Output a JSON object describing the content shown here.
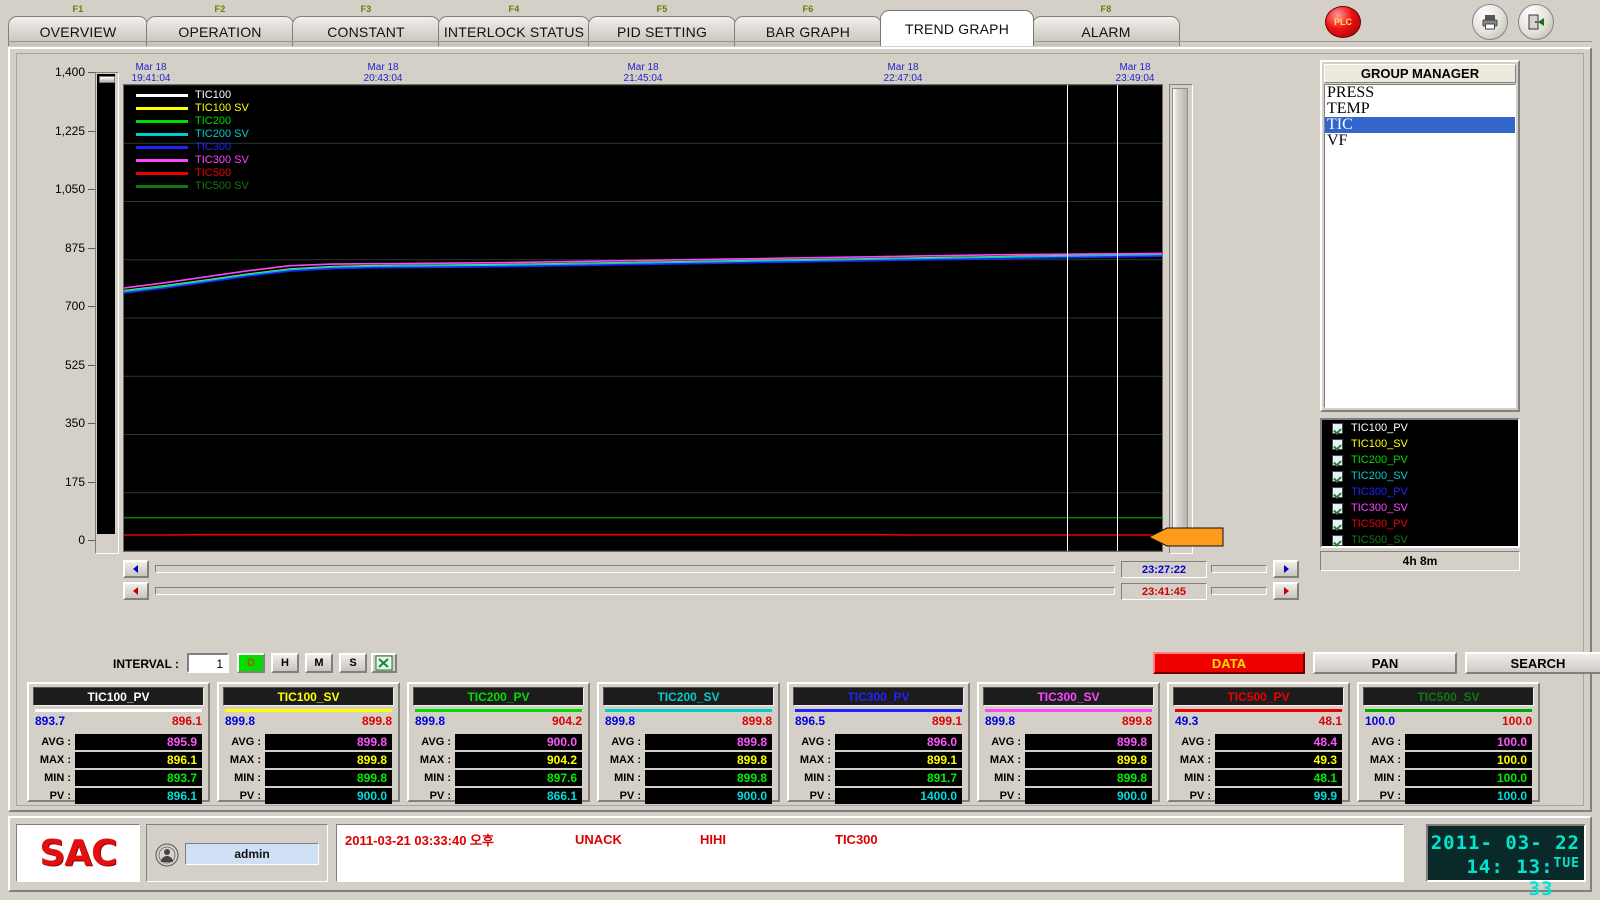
{
  "tabs": [
    {
      "fkey": "F1",
      "label": "OVERVIEW",
      "active": false
    },
    {
      "fkey": "F2",
      "label": "OPERATION",
      "active": false
    },
    {
      "fkey": "F3",
      "label": "CONSTANT",
      "active": false
    },
    {
      "fkey": "F4",
      "label": "INTERLOCK STATUS",
      "active": false
    },
    {
      "fkey": "F5",
      "label": "PID SETTING",
      "active": false
    },
    {
      "fkey": "F6",
      "label": "BAR GRAPH",
      "active": false
    },
    {
      "fkey": "",
      "label": "TREND GRAPH",
      "active": true
    },
    {
      "fkey": "F8",
      "label": "ALARM",
      "active": false
    }
  ],
  "titlebar": {
    "plc_label": "PLC",
    "plc_color": "#ee1111",
    "print_icon": "printer-icon",
    "exit_icon": "exit-door-icon"
  },
  "chart_data": {
    "type": "line",
    "title": "",
    "xlabel": "",
    "ylabel": "",
    "ylim": [
      0,
      1400
    ],
    "yticks": [
      "0",
      "175",
      "350",
      "525",
      "700",
      "875",
      "1,050",
      "1,225",
      "1,400"
    ],
    "grid": true,
    "legend_position": "top-left",
    "x_tick_labels": [
      {
        "date": "Mar 18",
        "time": "19:41:04"
      },
      {
        "date": "Mar 18",
        "time": "20:43:04"
      },
      {
        "date": "Mar 18",
        "time": "21:45:04"
      },
      {
        "date": "Mar 18",
        "time": "22:47:04"
      },
      {
        "date": "Mar 18",
        "time": "23:49:04"
      }
    ],
    "series": [
      {
        "name": "TIC100",
        "color": "#ffffff",
        "values": [
          780,
          795,
          812,
          830,
          845,
          852,
          855,
          856,
          857,
          858,
          860,
          862,
          864,
          866,
          868,
          870,
          872,
          874,
          876,
          878,
          880,
          882,
          884,
          886,
          888,
          890
        ]
      },
      {
        "name": "TIC100 SV",
        "color": "#ffff00",
        "values": [
          782,
          797,
          814,
          832,
          847,
          854,
          857,
          858,
          859,
          860,
          862,
          864,
          866,
          868,
          870,
          872,
          874,
          876,
          878,
          880,
          882,
          884,
          886,
          888,
          890,
          892
        ]
      },
      {
        "name": "TIC200",
        "color": "#00dd00",
        "values": [
          778,
          793,
          810,
          828,
          843,
          850,
          853,
          854,
          855,
          856,
          858,
          860,
          862,
          864,
          866,
          868,
          870,
          872,
          874,
          876,
          878,
          880,
          882,
          884,
          886,
          888
        ]
      },
      {
        "name": "TIC200 SV",
        "color": "#00cccc",
        "values": [
          781,
          796,
          813,
          831,
          846,
          853,
          856,
          857,
          858,
          859,
          861,
          863,
          865,
          867,
          869,
          871,
          873,
          875,
          877,
          879,
          881,
          883,
          885,
          887,
          889,
          891
        ]
      },
      {
        "name": "TIC300",
        "color": "#2222ff",
        "values": [
          775,
          790,
          808,
          826,
          841,
          848,
          851,
          852,
          853,
          854,
          856,
          858,
          860,
          862,
          864,
          866,
          868,
          870,
          872,
          874,
          876,
          878,
          880,
          882,
          884,
          886
        ]
      },
      {
        "name": "TIC300 SV",
        "color": "#ff44ff",
        "values": [
          790,
          806,
          824,
          842,
          857,
          862,
          863,
          864,
          865,
          866,
          868,
          870,
          872,
          874,
          876,
          878,
          880,
          882,
          884,
          886,
          888,
          890,
          891,
          892,
          893,
          894
        ]
      },
      {
        "name": "TIC500",
        "color": "#ee0000",
        "values": [
          48,
          48,
          49,
          49,
          49,
          49,
          49,
          49,
          49,
          49,
          49,
          49,
          49,
          49,
          49,
          49,
          49,
          49,
          49,
          48,
          48,
          48,
          48,
          48,
          48,
          48
        ]
      },
      {
        "name": "TIC500 SV",
        "color": "#117711",
        "values": [
          100,
          100,
          100,
          100,
          100,
          100,
          100,
          100,
          100,
          100,
          100,
          100,
          100,
          100,
          100,
          100,
          100,
          100,
          100,
          100,
          100,
          100,
          100,
          100,
          100,
          100
        ]
      }
    ],
    "cursors": [
      {
        "name": "cursor-a",
        "time": "23:27:22",
        "color": "#0000cc",
        "x_frac": 0.908
      },
      {
        "name": "cursor-b",
        "time": "23:41:45",
        "color": "#cc0000",
        "x_frac": 0.957
      }
    ]
  },
  "group_manager": {
    "title": "GROUP MANAGER",
    "items": [
      {
        "label": "PRESS",
        "selected": false
      },
      {
        "label": "TEMP",
        "selected": false
      },
      {
        "label": "TIC",
        "selected": true
      },
      {
        "label": "VF",
        "selected": false
      }
    ]
  },
  "tag_checklist": [
    {
      "label": "TIC100_PV",
      "color": "#ffffff",
      "checked": true
    },
    {
      "label": "TIC100_SV",
      "color": "#ffff00",
      "checked": true
    },
    {
      "label": "TIC200_PV",
      "color": "#00dd00",
      "checked": true
    },
    {
      "label": "TIC200_SV",
      "color": "#00cccc",
      "checked": true
    },
    {
      "label": "TIC300_PV",
      "color": "#2222ff",
      "checked": true
    },
    {
      "label": "TIC300_SV",
      "color": "#ff44ff",
      "checked": true
    },
    {
      "label": "TIC500_PV",
      "color": "#ee0000",
      "checked": true
    },
    {
      "label": "TIC500_SV",
      "color": "#117711",
      "checked": true
    }
  ],
  "duration_label": "4h 8m",
  "toolbar": {
    "interval_label": "INTERVAL :",
    "interval_value": "1",
    "unit_buttons": [
      {
        "label": "D",
        "active": true
      },
      {
        "label": "H",
        "active": false
      },
      {
        "label": "M",
        "active": false
      },
      {
        "label": "S",
        "active": false
      }
    ],
    "excel_icon": "excel-export-icon",
    "mode_buttons": [
      {
        "label": "DATA",
        "active": true
      },
      {
        "label": "PAN",
        "active": false
      },
      {
        "label": "SEARCH",
        "active": false
      }
    ]
  },
  "panels": [
    {
      "title": "TIC100_PV",
      "title_color": "#ffffff",
      "bar_color": "#ffffff",
      "lo": "893.7",
      "hi": "896.1",
      "rows": [
        {
          "key": "AVG :",
          "value": "895.9",
          "color": "#ff55ff"
        },
        {
          "key": "MAX :",
          "value": "896.1",
          "color": "#ffff00"
        },
        {
          "key": "MIN :",
          "value": "893.7",
          "color": "#00ee00"
        },
        {
          "key": "PV :",
          "value": "896.1",
          "color": "#00dddd"
        }
      ]
    },
    {
      "title": "TIC100_SV",
      "title_color": "#ffff00",
      "bar_color": "#ffff00",
      "lo": "899.8",
      "hi": "899.8",
      "rows": [
        {
          "key": "AVG :",
          "value": "899.8",
          "color": "#ff55ff"
        },
        {
          "key": "MAX :",
          "value": "899.8",
          "color": "#ffff00"
        },
        {
          "key": "MIN :",
          "value": "899.8",
          "color": "#00ee00"
        },
        {
          "key": "PV :",
          "value": "900.0",
          "color": "#00dddd"
        }
      ]
    },
    {
      "title": "TIC200_PV",
      "title_color": "#00dd00",
      "bar_color": "#00dd00",
      "lo": "899.8",
      "hi": "904.2",
      "rows": [
        {
          "key": "AVG :",
          "value": "900.0",
          "color": "#ff55ff"
        },
        {
          "key": "MAX :",
          "value": "904.2",
          "color": "#ffff00"
        },
        {
          "key": "MIN :",
          "value": "897.6",
          "color": "#00ee00"
        },
        {
          "key": "PV :",
          "value": "866.1",
          "color": "#00dddd"
        }
      ]
    },
    {
      "title": "TIC200_SV",
      "title_color": "#00cccc",
      "bar_color": "#00cccc",
      "lo": "899.8",
      "hi": "899.8",
      "rows": [
        {
          "key": "AVG :",
          "value": "899.8",
          "color": "#ff55ff"
        },
        {
          "key": "MAX :",
          "value": "899.8",
          "color": "#ffff00"
        },
        {
          "key": "MIN :",
          "value": "899.8",
          "color": "#00ee00"
        },
        {
          "key": "PV :",
          "value": "900.0",
          "color": "#00dddd"
        }
      ]
    },
    {
      "title": "TIC300_PV",
      "title_color": "#2222ff",
      "bar_color": "#2222ff",
      "lo": "896.5",
      "hi": "899.1",
      "rows": [
        {
          "key": "AVG :",
          "value": "896.0",
          "color": "#ff55ff"
        },
        {
          "key": "MAX :",
          "value": "899.1",
          "color": "#ffff00"
        },
        {
          "key": "MIN :",
          "value": "891.7",
          "color": "#00ee00"
        },
        {
          "key": "PV :",
          "value": "1400.0",
          "color": "#00dddd"
        }
      ]
    },
    {
      "title": "TIC300_SV",
      "title_color": "#ff44ff",
      "bar_color": "#ff44ff",
      "lo": "899.8",
      "hi": "899.8",
      "rows": [
        {
          "key": "AVG :",
          "value": "899.8",
          "color": "#ff55ff"
        },
        {
          "key": "MAX :",
          "value": "899.8",
          "color": "#ffff00"
        },
        {
          "key": "MIN :",
          "value": "899.8",
          "color": "#00ee00"
        },
        {
          "key": "PV :",
          "value": "900.0",
          "color": "#00dddd"
        }
      ]
    },
    {
      "title": "TIC500_PV",
      "title_color": "#ee0000",
      "bar_color": "#ee0000",
      "lo": "49.3",
      "hi": "48.1",
      "rows": [
        {
          "key": "AVG :",
          "value": "48.4",
          "color": "#ff55ff"
        },
        {
          "key": "MAX :",
          "value": "49.3",
          "color": "#ffff00"
        },
        {
          "key": "MIN :",
          "value": "48.1",
          "color": "#00ee00"
        },
        {
          "key": "PV :",
          "value": "99.9",
          "color": "#00dddd"
        }
      ]
    },
    {
      "title": "TIC500_SV",
      "title_color": "#117711",
      "bar_color": "#00aa00",
      "lo": "100.0",
      "hi": "100.0",
      "rows": [
        {
          "key": "AVG :",
          "value": "100.0",
          "color": "#ff55ff"
        },
        {
          "key": "MAX :",
          "value": "100.0",
          "color": "#ffff00"
        },
        {
          "key": "MIN :",
          "value": "100.0",
          "color": "#00ee00"
        },
        {
          "key": "PV :",
          "value": "100.0",
          "color": "#00dddd"
        }
      ]
    }
  ],
  "statusbar": {
    "logo_text": "SAC",
    "user_icon": "user-badge-icon",
    "user_name": "admin",
    "alarm": {
      "timestamp": "2011-03-21 03:33:40 오후",
      "ack_state": "UNACK",
      "severity": "HIHI",
      "tag": "TIC300"
    },
    "clock": {
      "date": "2011- 03- 22",
      "time": "14: 13: 33",
      "weekday": "TUE"
    }
  }
}
